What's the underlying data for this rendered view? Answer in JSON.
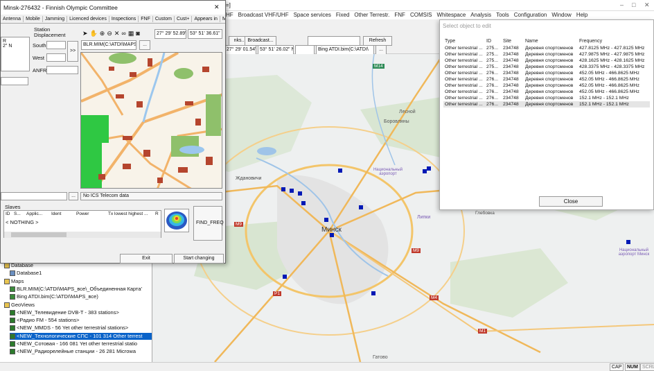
{
  "app": {
    "title_fragment": "s=]",
    "menu": [
      "HF",
      "Broadcast VHF/UHF",
      "Space services",
      "Fixed",
      "Other Terrestr.",
      "FNF",
      "COMSIS",
      "Whitespace",
      "Analysis",
      "Tools",
      "Configuration",
      "Window",
      "Help"
    ],
    "toolbar": {
      "tab1": "nks...",
      "tab2": "Broadcast...",
      "refresh": "Refresh",
      "coord1": "27° 29' 01.54\" E",
      "coord2": "53° 51' 26.02\" N",
      "map_select": "Bing ATDI.bim(C:\\ATDI\\",
      "more": "..."
    },
    "window_controls": {
      "minimize": "–",
      "maximize": "□",
      "close": "✕"
    }
  },
  "station_dialog": {
    "title": "Minsk-276432 - Finnish Olympic Committee",
    "close": "✕",
    "tabs": [
      "Antenna",
      "Mobile",
      "Jamming",
      "Licenced devices",
      "Inspections",
      "FNF",
      "Custom",
      "Cust+",
      "Appears in",
      "Moni"
    ],
    "displacement_label": "Station Displacement",
    "south_label": "South",
    "west_label": "West",
    "anfr_label": "ANFR",
    "shift_btn": ">>",
    "left_snippet1": "R",
    "left_snippet2": "2\" N",
    "coord_lon": "27° 29' 52.89\" E",
    "coord_lat": "53° 51' 36.61\" N",
    "map_select": "BLR.MIM(C:\\ATDI\\MAPS",
    "more": "...",
    "ics_text": "No ICS Telecom data",
    "slaves_label": "Slaves",
    "slaves_columns": [
      "ID",
      "S...",
      "Applic...",
      "Ident",
      "Power",
      "Tx lowest highest ...",
      "R"
    ],
    "slaves_empty": "< NOTHING >",
    "find_freq": "FIND_FREQ",
    "exit": "Exit",
    "start_changing": "Start changing"
  },
  "tree": {
    "rows": [
      {
        "label": "Database",
        "icon": "folder-icon"
      },
      {
        "label": "Database1",
        "icon": "database-icon"
      },
      {
        "label": "Maps",
        "icon": "folder-icon"
      },
      {
        "label": "BLR.MIM(C:\\ATDI\\MAPS_все\\_Объединенная Карта'",
        "icon": "map-icon"
      },
      {
        "label": "Bing ATDI.bim(C:\\ATDI\\MAPS_все)",
        "icon": "map-icon"
      },
      {
        "label": "GeoViews",
        "icon": "folder-icon"
      },
      {
        "label": "<NEW_Телевидение DVB-T - 383  stations>",
        "icon": "geoview-icon"
      },
      {
        "label": "<Радио FM - 554  stations>",
        "icon": "geoview-icon"
      },
      {
        "label": "<NEW_MMDS - 56  Yet other terrestrial stations>",
        "icon": "geoview-icon"
      },
      {
        "label": "<NEW_Технологические СПС - 101 314 Other terrest",
        "icon": "geoview-icon"
      },
      {
        "label": "<NEW_Сотовая - 166 081  Yet other terrestrial statio",
        "icon": "geoview-icon"
      },
      {
        "label": "<NEW_Радиорелейные станции - 26 281  Microwa",
        "icon": "geoview-icon"
      }
    ]
  },
  "select_dialog": {
    "title": "Select object to edit",
    "columns": [
      "Type",
      "ID",
      "Site",
      "Name",
      "Frequency"
    ],
    "rows": [
      [
        "Other terrestrial ...",
        "275...",
        "234748",
        "Деревня спортсменов",
        "427.8125 MHz - 427.8125 MHz"
      ],
      [
        "Other terrestrial ...",
        "275...",
        "234748",
        "Деревня спортсменов",
        "427.9875 MHz - 427.9875 MHz"
      ],
      [
        "Other terrestrial ...",
        "275...",
        "234748",
        "Деревня спортсменов",
        "428.1625 MHz - 428.1625 MHz"
      ],
      [
        "Other terrestrial ...",
        "275...",
        "234748",
        "Деревня спортсменов",
        "428.3375 MHz - 428.3375 MHz"
      ],
      [
        "Other terrestrial ...",
        "276...",
        "234748",
        "Деревня спортсменов",
        "452.05 MHz - 466.8625 MHz"
      ],
      [
        "Other terrestrial ...",
        "276...",
        "234748",
        "Деревня спортсменов",
        "452.05 MHz - 466.8625 MHz"
      ],
      [
        "Other terrestrial ...",
        "276...",
        "234748",
        "Деревня спортсменов",
        "452.05 MHz - 466.8625 MHz"
      ],
      [
        "Other terrestrial ...",
        "276...",
        "234748",
        "Деревня спортсменов",
        "452.05 MHz - 466.8625 MHz"
      ],
      [
        "Other terrestrial ...",
        "276...",
        "234748",
        "Деревня спортсменов",
        "152.1 MHz - 152.1 MHz"
      ],
      [
        "Other terrestrial ...",
        "276...",
        "234748",
        "Деревня спортсменов",
        "152.1 MHz - 152.1 MHz"
      ]
    ],
    "close": "Close"
  },
  "map_labels": {
    "m14": "M14",
    "lesnoy": "Лесной",
    "borovlyany": "Боровляны",
    "zhdanovichi": "Ждановичи",
    "airport1": "Национальный аэропорт",
    "minsk": "Минск",
    "lipki": "Липки",
    "gleboeka": "Глебовка",
    "m9a": "M9",
    "m9b": "M9",
    "p1": "P1",
    "m4": "M4",
    "m1": "M1",
    "airport2": "Национальный аэропорт Минск",
    "gatovo": "Гатово"
  },
  "status": {
    "cap": "CAP",
    "num": "NUM",
    "scrl": "SCRL"
  }
}
